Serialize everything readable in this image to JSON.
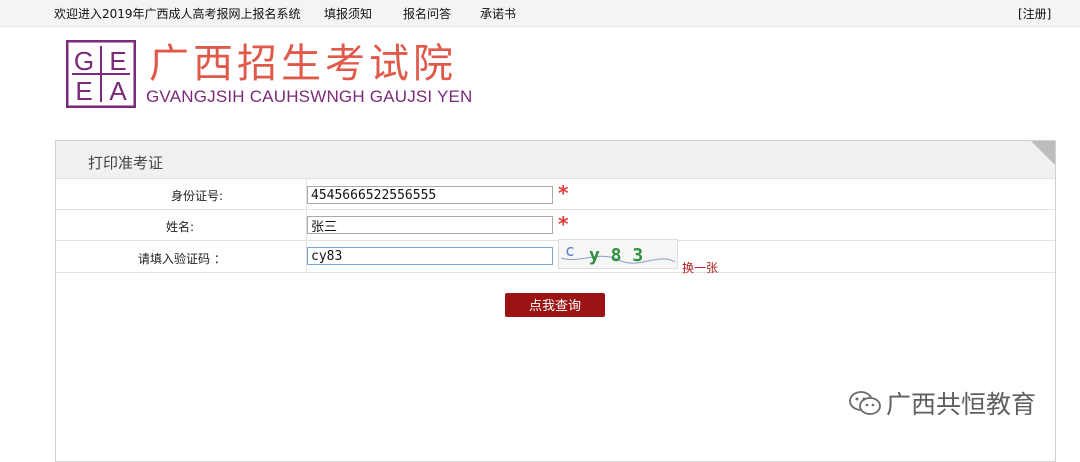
{
  "topbar": {
    "welcome": "欢迎进入2019年广西成人高考报网上报名系统",
    "links": [
      "填报须知",
      "报名问答",
      "承诺书"
    ],
    "logout": "[注册]"
  },
  "brand": {
    "logo_letters": [
      "G",
      "E",
      "E",
      "A"
    ],
    "name_cn": "广西招生考试院",
    "name_en": "GVANGJSIH CAUHSWNGH GAUJSI YEN"
  },
  "panel": {
    "title": "打印准考证",
    "fields": {
      "id_label": "身份证号:",
      "id_value": "4545666522556555",
      "name_label": "姓名:",
      "name_value": "张三",
      "captcha_label": "请填入验证码 ：",
      "captcha_value": "cy83",
      "required_mark": "*",
      "captcha_text": "y 8 3",
      "refresh_label": "换一张"
    },
    "submit_label": "点我查询"
  },
  "watermark": {
    "text": "广西共恒教育",
    "icon": "wechat-icon"
  },
  "colors": {
    "brand_red": "#e05a4b",
    "brand_purple": "#7b2a7a",
    "button_red": "#9c1313",
    "star_red": "#e03a3a"
  }
}
